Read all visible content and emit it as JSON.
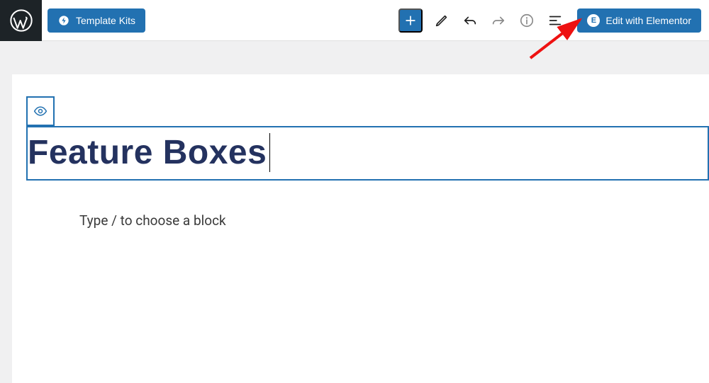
{
  "topbar": {
    "template_kits_label": "Template Kits",
    "elementor_label": "Edit with Elementor"
  },
  "editor": {
    "title": "Feature Boxes",
    "placeholder": "Type / to choose a block"
  },
  "colors": {
    "primary": "#2271b1",
    "title": "#24325f",
    "wp_dark": "#1d2327"
  }
}
